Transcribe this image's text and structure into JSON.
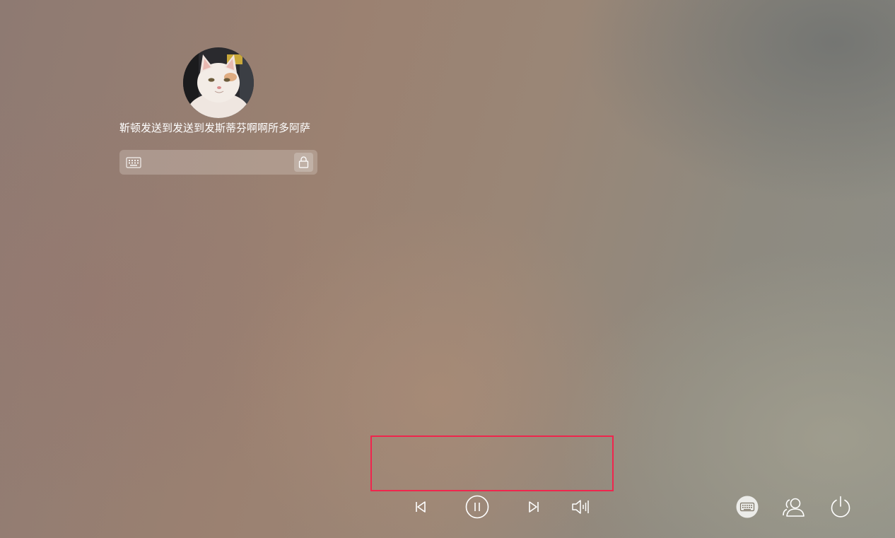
{
  "user": {
    "name": "靳顿发送到发送到发斯蒂芬啊啊所多阿萨",
    "avatar_icon": "cat-avatar"
  },
  "password": {
    "value": "",
    "placeholder": "",
    "keyboard_icon": "keyboard-icon",
    "submit_icon": "lock-icon"
  },
  "media_controls": {
    "previous_icon": "skip-previous-icon",
    "play_pause_icon": "pause-icon",
    "next_icon": "skip-next-icon",
    "volume_icon": "volume-icon"
  },
  "system_controls": {
    "keyboard_layout_icon": "keyboard-icon",
    "switch_user_icon": "users-icon",
    "power_icon": "power-icon"
  },
  "colors": {
    "highlight": "#f0254d",
    "text": "#ffffff"
  }
}
